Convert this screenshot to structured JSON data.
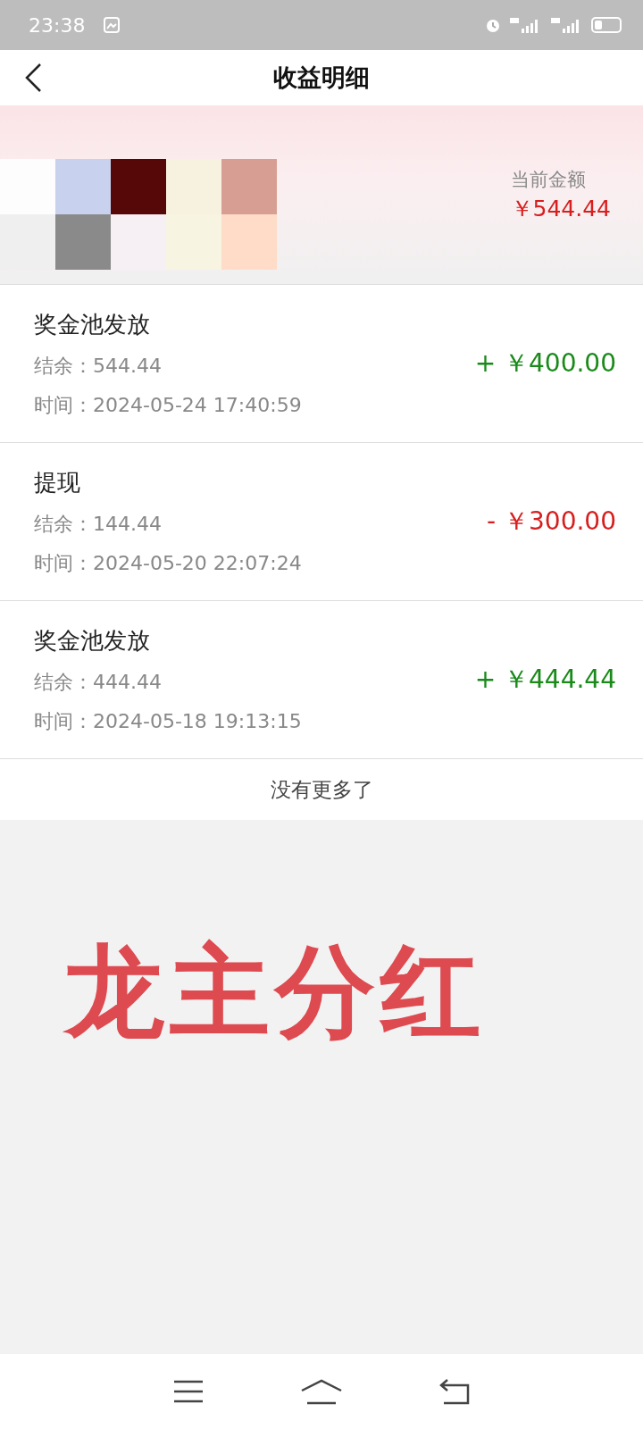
{
  "status_bar": {
    "time": "23:38"
  },
  "header": {
    "title": "收益明细"
  },
  "summary": {
    "label": "当前金额",
    "amount": "￥544.44"
  },
  "records": [
    {
      "title": "奖金池发放",
      "balance_label": "结余：",
      "balance": "544.44",
      "time_label": "时间：",
      "time": "2024-05-24 17:40:59",
      "amount": "+ ￥400.00",
      "kind": "income"
    },
    {
      "title": "提现",
      "balance_label": "结余：",
      "balance": "144.44",
      "time_label": "时间：",
      "time": "2024-05-20 22:07:24",
      "amount": "- ￥300.00",
      "kind": "expense"
    },
    {
      "title": "奖金池发放",
      "balance_label": "结余：",
      "balance": "444.44",
      "time_label": "时间：",
      "time": "2024-05-18 19:13:15",
      "amount": "+ ￥444.44",
      "kind": "income"
    }
  ],
  "end_note": "没有更多了",
  "overlay_text": "龙主分红"
}
